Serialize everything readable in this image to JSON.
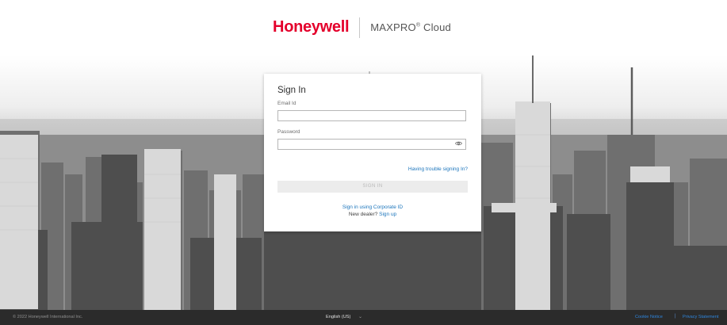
{
  "header": {
    "brand": "Honeywell",
    "product": "MAXPRO",
    "product_reg": "®",
    "product_suffix": "Cloud"
  },
  "signin": {
    "title": "Sign In",
    "email_label": "Email Id",
    "email_value": "",
    "password_label": "Password",
    "password_value": "",
    "trouble_link": "Having trouble signing In?",
    "button_label": "SIGN IN",
    "corporate_link": "Sign in using Corporate ID",
    "dealer_text": "New dealer?",
    "signup_link": "Sign up"
  },
  "footer": {
    "copyright": "© 2022 Honeywell International Inc.",
    "language": "English (US)",
    "cookie_notice": "Cookie Notice",
    "separator": "|",
    "privacy": "Privacy Statement"
  },
  "icons": {
    "show_password": "eye-icon",
    "language_dropdown": "chevron-down-icon"
  },
  "colors": {
    "brand_red": "#e4002b",
    "link_blue": "#1c75bc",
    "footer_bg": "#2b2b2b",
    "button_disabled_bg": "#ececec"
  }
}
